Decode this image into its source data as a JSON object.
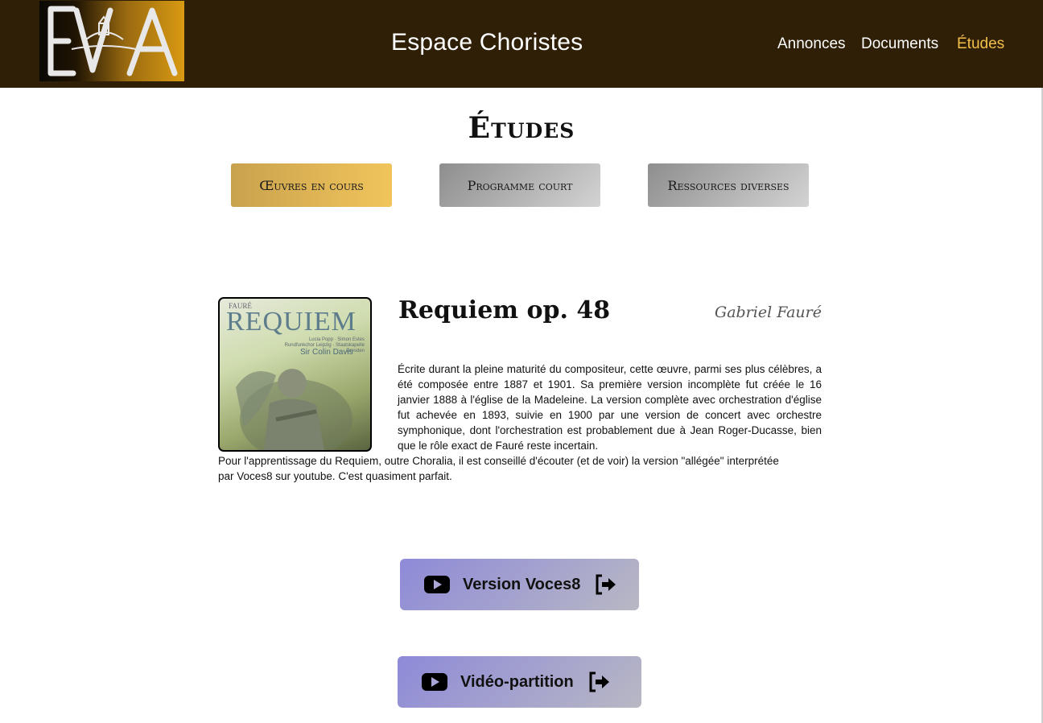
{
  "header": {
    "logo_text": "EVA",
    "site_title": "Espace Choristes",
    "nav": [
      {
        "label": "Annonces",
        "active": false
      },
      {
        "label": "Documents",
        "active": false
      },
      {
        "label": "Études",
        "active": true
      }
    ]
  },
  "page": {
    "title": "Études",
    "tabs": [
      {
        "label": "Œuvres en cours",
        "active": true
      },
      {
        "label": "Programme court",
        "active": false
      },
      {
        "label": "Ressources diverses",
        "active": false
      }
    ]
  },
  "work": {
    "cover": {
      "composer_small": "FAURÉ",
      "title": "REQUIEM",
      "credits_line1": "Lucia Popp · Simon Estes",
      "credits_line2": "Rundfunkchor Leipzig · Staatskapelle Dresden",
      "conductor": "Sir Colin Davis"
    },
    "title": "Requiem op. 48",
    "composer": "Gabriel Fauré",
    "description": "Écrite durant la pleine maturité du compositeur, cette œuvre, parmi ses plus célèbres, a été composée entre 1887 et 1901. Sa première version incomplète fut créée le 16 janvier 1888 à l'église de la Madeleine. La version complète avec orchestration d'église fut achevée en 1893, suivie en 1900 par une version de concert avec orchestre symphonique, dont l'orchestration est probablement due à Jean Roger-Ducasse, bien que le rôle exact de Fauré reste incertain.",
    "note": "Pour l'apprentissage du Requiem, outre Choralia, il est conseillé d'écouter (et de voir) la version \"allégée\" interprétée par Voces8 sur youtube. C'est quasiment parfait.",
    "links": [
      {
        "label": "Version Voces8",
        "icon": "youtube-icon",
        "ext_icon": "external-link-icon"
      },
      {
        "label": "Vidéo-partition",
        "icon": "youtube-icon",
        "ext_icon": "external-link-icon"
      }
    ]
  },
  "colors": {
    "header_bg": "#2f1f06",
    "nav_active": "#f2c04a",
    "tab_active": "#e3b756",
    "tab_inactive": "#a9a9a9",
    "link_button": "#a5a3d0"
  }
}
